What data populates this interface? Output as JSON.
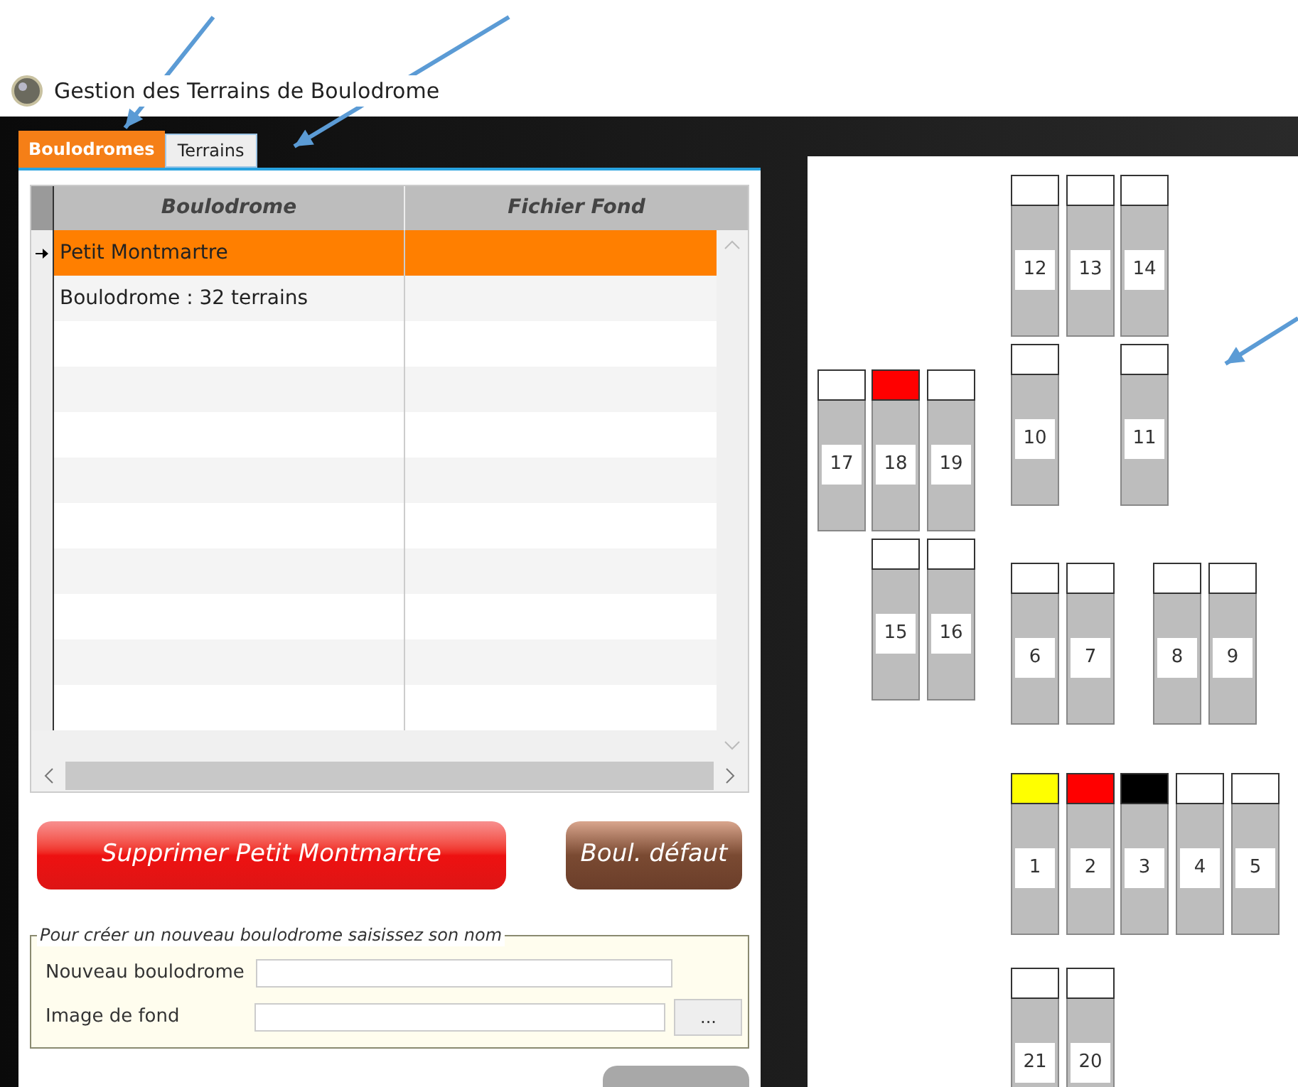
{
  "window": {
    "title": "Gestion des Terrains de Boulodrome"
  },
  "tabs": [
    {
      "label": "Boulodromes",
      "selected": true
    },
    {
      "label": "Terrains",
      "selected": false
    }
  ],
  "table": {
    "columns": [
      "Boulodrome",
      "Fichier Fond"
    ],
    "rows": [
      {
        "cells": [
          "Petit Montmartre",
          ""
        ],
        "selected": true
      },
      {
        "cells": [
          "Boulodrome : 32 terrains",
          ""
        ],
        "selected": false
      }
    ]
  },
  "buttons": [
    {
      "label": "Supprimer Petit Montmartre",
      "kind": "danger"
    },
    {
      "label": "Boul. défaut",
      "kind": "brown"
    }
  ],
  "new_group": {
    "legend": "Pour créer un nouveau boulodrome saisissez son nom",
    "fields": [
      {
        "label": "Nouveau boulodrome",
        "browse": false
      },
      {
        "label": "Image de fond",
        "browse": true,
        "browse_label": "..."
      }
    ]
  },
  "courts": [
    {
      "number": "12",
      "color": "#ffffff"
    },
    {
      "number": "13",
      "color": "#ffffff"
    },
    {
      "number": "14",
      "color": "#ffffff"
    },
    {
      "number": "10",
      "color": "#ffffff"
    },
    {
      "number": "11",
      "color": "#ffffff"
    },
    {
      "number": "17",
      "color": "#ffffff"
    },
    {
      "number": "18",
      "color": "#ff0000"
    },
    {
      "number": "19",
      "color": "#ffffff"
    },
    {
      "number": "15",
      "color": "#ffffff"
    },
    {
      "number": "16",
      "color": "#ffffff"
    },
    {
      "number": "6",
      "color": "#ffffff"
    },
    {
      "number": "7",
      "color": "#ffffff"
    },
    {
      "number": "8",
      "color": "#ffffff"
    },
    {
      "number": "9",
      "color": "#ffffff"
    },
    {
      "number": "1",
      "color": "#ffff00"
    },
    {
      "number": "2",
      "color": "#ff0000"
    },
    {
      "number": "3",
      "color": "#000000"
    },
    {
      "number": "4",
      "color": "#ffffff"
    },
    {
      "number": "5",
      "color": "#ffffff"
    },
    {
      "number": "21",
      "color": "#ffffff"
    },
    {
      "number": "20",
      "color": "#ffffff"
    }
  ]
}
